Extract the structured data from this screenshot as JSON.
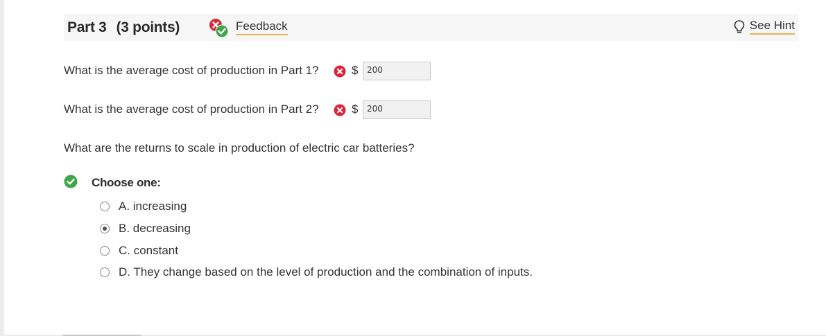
{
  "header": {
    "part_label": "Part 3",
    "points_label": "(3 points)",
    "feedback_label": "Feedback",
    "feedback_icon": "mixed-result-icon",
    "hint_label": "See Hint",
    "hint_icon": "lightbulb-icon"
  },
  "questions": [
    {
      "text": "What is the average cost of production in Part 1?",
      "status": "incorrect",
      "currency": "$",
      "value": "200"
    },
    {
      "text": "What is the average cost of production in Part 2?",
      "status": "incorrect",
      "currency": "$",
      "value": "200"
    }
  ],
  "mc": {
    "question": "What are the returns to scale in production of electric car batteries?",
    "status": "correct",
    "prompt": "Choose one:",
    "options": [
      {
        "label": "A. increasing",
        "selected": false
      },
      {
        "label": "B. decreasing",
        "selected": true
      },
      {
        "label": "C. constant",
        "selected": false
      },
      {
        "label": "D. They change based on the level of production and the combination of inputs.",
        "selected": false
      }
    ]
  },
  "colors": {
    "incorrect": "#d9263b",
    "correct": "#3fa64a",
    "link_underline": "#e3b553"
  }
}
